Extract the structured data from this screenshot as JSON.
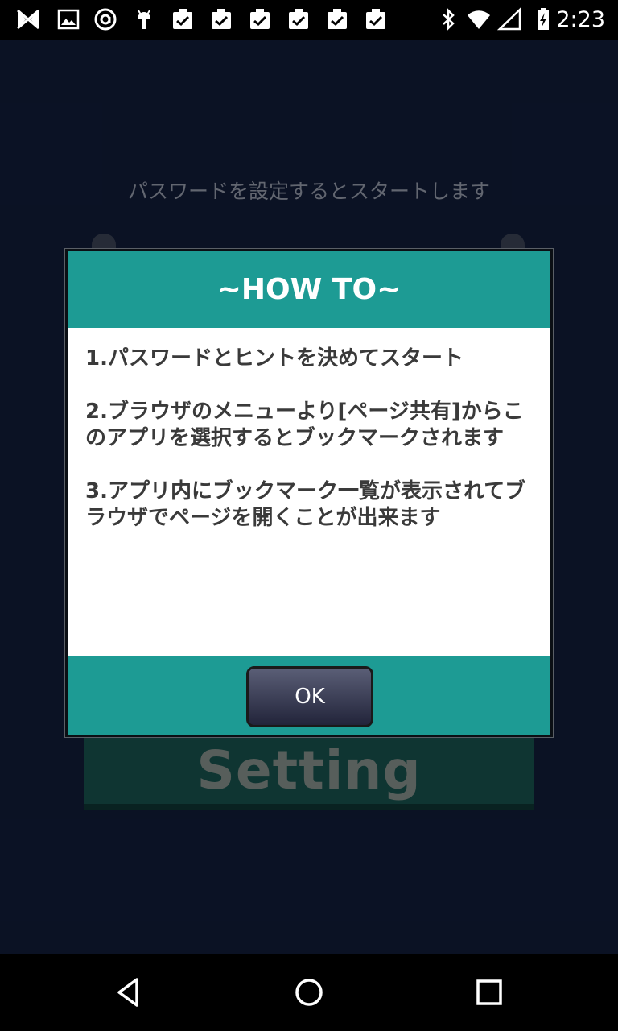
{
  "status_bar": {
    "time": "2:23",
    "icons_left": [
      "nexus-logo-icon",
      "image-icon",
      "at-sign-icon",
      "android-icon",
      "clipboard-check-icon",
      "clipboard-check-icon",
      "clipboard-check-icon",
      "clipboard-check-icon",
      "clipboard-check-icon",
      "clipboard-check-icon"
    ],
    "icons_right": [
      "bluetooth-icon",
      "wifi-icon",
      "signal-icon",
      "battery-charging-icon"
    ]
  },
  "background": {
    "instruction": "パスワードを設定するとスタートします",
    "setting_button_label": "Setting",
    "accent_color": "#1d9b94"
  },
  "dialog": {
    "title": "~HOW TO~",
    "steps": [
      "1.パスワードとヒントを決めてスタート",
      "2.ブラウザのメニューより[ページ共有]からこのアプリを選択するとブックマークされます",
      "3.アプリ内にブックマーク一覧が表示されてブラウザでページを開くことが出来ます"
    ],
    "ok_label": "OK"
  },
  "nav_bar": {
    "buttons": [
      "back-icon",
      "home-icon",
      "recents-icon"
    ]
  }
}
